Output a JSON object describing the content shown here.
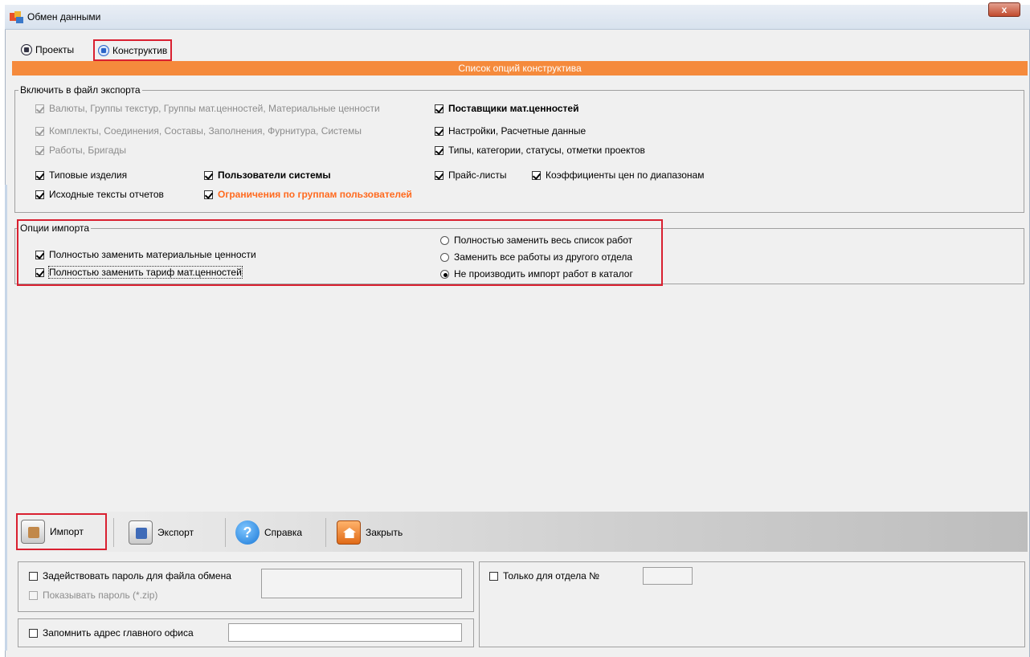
{
  "window": {
    "title": "Обмен данными",
    "close_glyph": "x"
  },
  "tabs": [
    {
      "label": "Проекты",
      "icon": "projects-icon"
    },
    {
      "label": "Конструктив",
      "icon": "constructive-icon"
    }
  ],
  "header_bar": {
    "label": "Список опций конструктива",
    "color": "#f58a3c"
  },
  "export_group": {
    "legend": "Включить в файл экспорта",
    "items": {
      "currencies": {
        "label": "Валюты, Группы текстур, Группы мат.ценностей, Материальные ценности",
        "checked": true,
        "enabled": false
      },
      "sets": {
        "label": "Комплекты, Соединения, Составы, Заполнения, Фурнитура, Системы",
        "checked": true,
        "enabled": false
      },
      "works": {
        "label": "Работы, Бригады",
        "checked": true,
        "enabled": false
      },
      "suppliers": {
        "label": "Поставщики мат.ценностей",
        "checked": true
      },
      "settings": {
        "label": "Настройки, Расчетные данные",
        "checked": true
      },
      "types": {
        "label": "Типы, категории, статусы, отметки проектов",
        "checked": true
      },
      "typical": {
        "label": "Типовые изделия",
        "checked": true
      },
      "users": {
        "label": "Пользователи системы",
        "checked": true
      },
      "price_lists": {
        "label": "Прайс-листы",
        "checked": true
      },
      "coefficients": {
        "label": "Коэффициенты цен по диапазонам",
        "checked": true
      },
      "report_sources": {
        "label": "Исходные тексты отчетов",
        "checked": true
      },
      "group_limits": {
        "label": "Ограничения по группам пользователей",
        "checked": true
      }
    }
  },
  "import_group": {
    "legend": "Опции импорта",
    "replace_materials": {
      "label": "Полностью заменить материальные ценности",
      "checked": true
    },
    "replace_tariff": {
      "label": "Полностью заменить тариф мат.ценностей",
      "checked": true
    },
    "radios": [
      {
        "label": "Полностью заменить весь список работ",
        "selected": false
      },
      {
        "label": "Заменить все работы из другого отдела",
        "selected": false
      },
      {
        "label": "Не производить импорт работ в каталог",
        "selected": true
      }
    ]
  },
  "toolbar": {
    "import_label": "Импорт",
    "export_label": "Экспорт",
    "help_label": "Справка",
    "help_glyph": "?",
    "close_label": "Закрыть"
  },
  "bottom": {
    "use_password": {
      "label": "Задействовать пароль для файла обмена",
      "checked": false
    },
    "show_password": {
      "label": "Показывать пароль (*.zip)",
      "checked": false,
      "enabled": false
    },
    "password_value": "",
    "remember_office": {
      "label": "Запомнить адрес главного офиса",
      "checked": false
    },
    "office_value": "",
    "only_department": {
      "label": "Только для отдела №",
      "checked": false
    },
    "department_value": ""
  }
}
